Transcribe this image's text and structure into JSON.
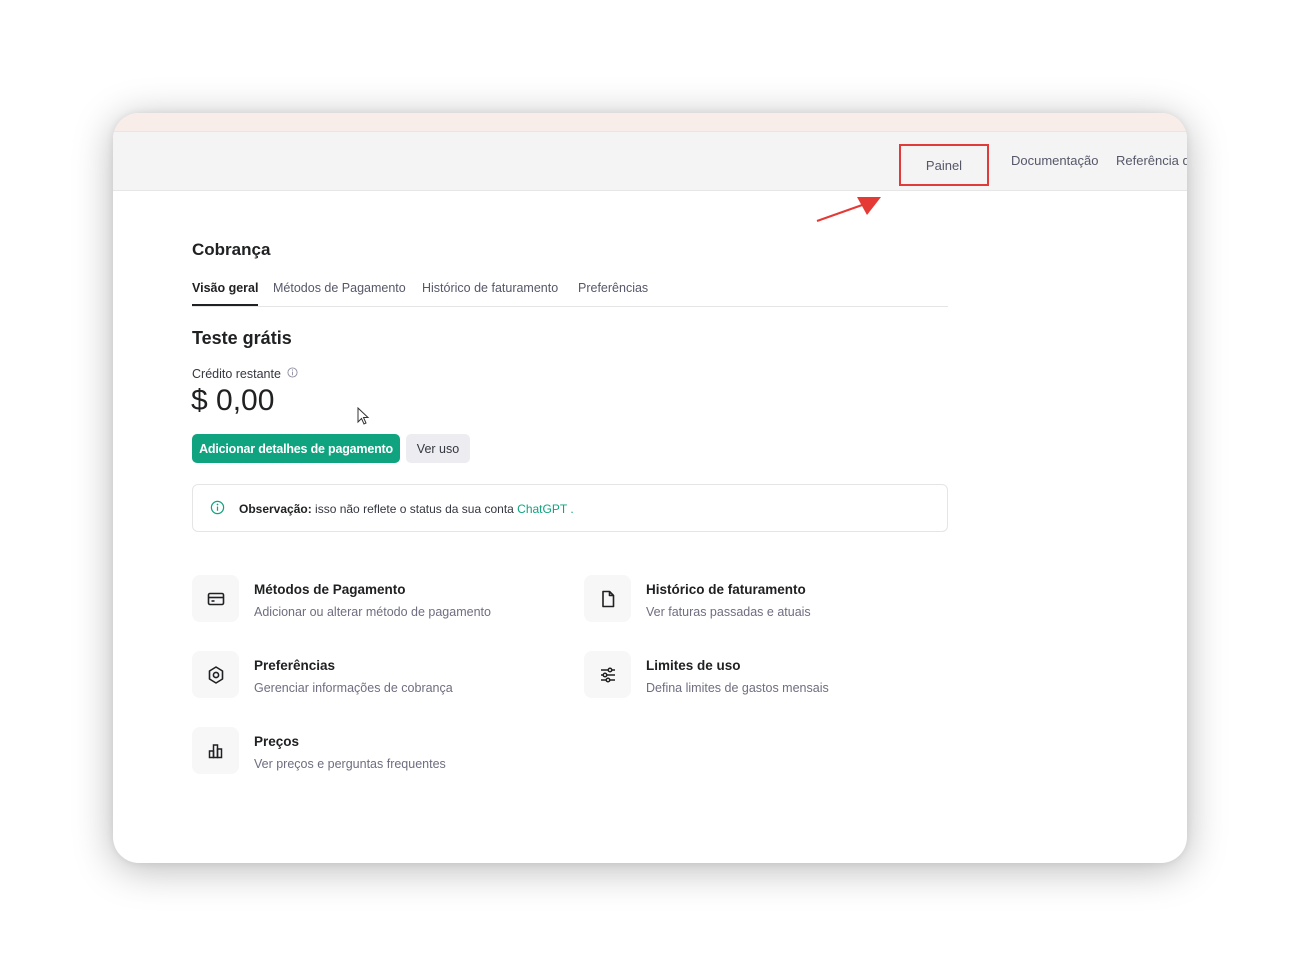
{
  "navbar": {
    "painel": "Painel",
    "documentacao": "Documentação",
    "referencia": "Referência d"
  },
  "page": {
    "title": "Cobrança",
    "tabs": [
      "Visão geral",
      "Métodos de Pagamento",
      "Histórico de faturamento",
      "Preferências"
    ],
    "active_tab": "Visão geral"
  },
  "trial": {
    "title": "Teste grátis",
    "credit_label": "Crédito restante",
    "credit_value": "$ 0,00",
    "add_payment_button": "Adicionar detalhes de pagamento",
    "view_usage_button": "Ver uso"
  },
  "note": {
    "label": "Observação:",
    "text": " isso não reflete o status da sua conta ",
    "link": "ChatGPT",
    "suffix": " ."
  },
  "cards": [
    {
      "title": "Métodos de Pagamento",
      "description": "Adicionar ou alterar método de pagamento",
      "icon": "credit-card-icon"
    },
    {
      "title": "Histórico de faturamento",
      "description": "Ver faturas passadas e atuais",
      "icon": "document-icon"
    },
    {
      "title": "Preferências",
      "description": "Gerenciar informações de cobrança",
      "icon": "gear-icon"
    },
    {
      "title": "Limites de uso",
      "description": "Defina limites de gastos mensais",
      "icon": "sliders-icon"
    },
    {
      "title": "Preços",
      "description": "Ver preços e perguntas frequentes",
      "icon": "bar-chart-icon"
    }
  ],
  "colors": {
    "accent": "#10a37f",
    "highlight_box": "#e03a3a",
    "annotation_arrow": "#e53935"
  }
}
